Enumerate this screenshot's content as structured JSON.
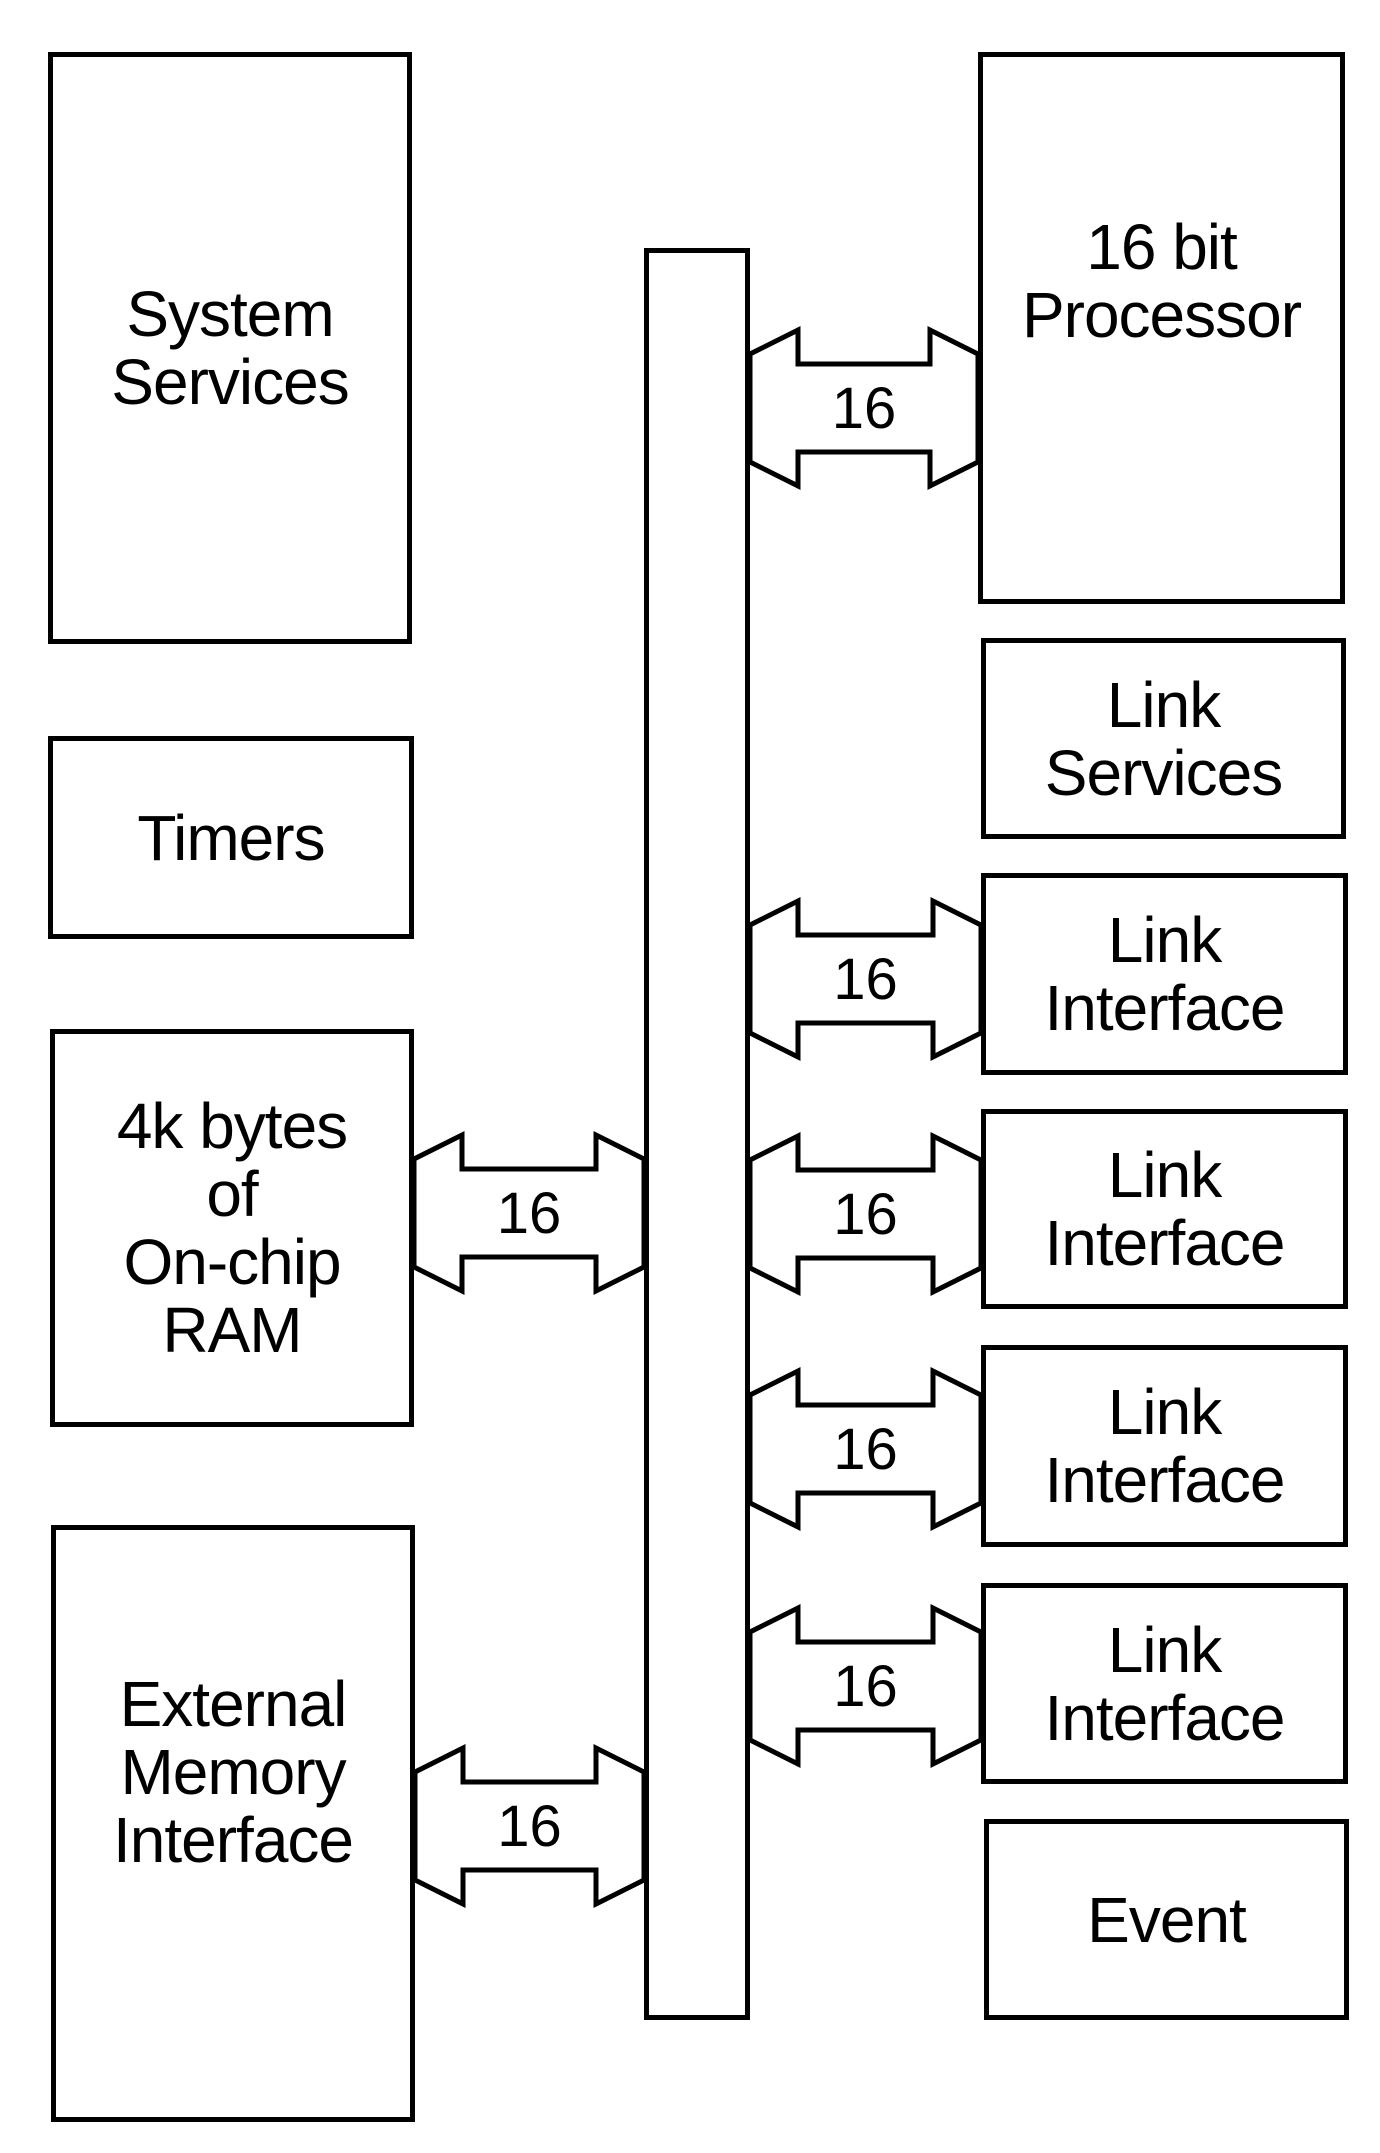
{
  "diagram": {
    "blocks": {
      "system_services": "System\nServices",
      "timers": "Timers",
      "ram": "4k bytes\nof\nOn-chip\nRAM",
      "external_memory": "External\nMemory\nInterface",
      "processor": "16 bit\nProcessor",
      "link_services": "Link\nServices",
      "link_interface_1": "Link\nInterface",
      "link_interface_2": "Link\nInterface",
      "link_interface_3": "Link\nInterface",
      "link_interface_4": "Link\nInterface",
      "event": "Event"
    },
    "connections": [
      {
        "from": "bus",
        "to": "processor",
        "width": "16"
      },
      {
        "from": "bus",
        "to": "link_interface_1",
        "width": "16"
      },
      {
        "from": "bus",
        "to": "link_interface_2",
        "width": "16"
      },
      {
        "from": "bus",
        "to": "link_interface_3",
        "width": "16"
      },
      {
        "from": "bus",
        "to": "link_interface_4",
        "width": "16"
      },
      {
        "from": "ram",
        "to": "bus",
        "width": "16"
      },
      {
        "from": "external_memory",
        "to": "bus",
        "width": "16"
      }
    ]
  }
}
